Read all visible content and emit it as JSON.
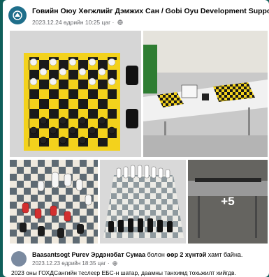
{
  "post": {
    "page_name": "Говийн Оюу Хөгжлийг Дэмжих Сан / Gobi Oyu Development Support Fund",
    "time": "2023.12.24 өдрийн 10:25 цаг ·"
  },
  "photos": {
    "more_label": "+5"
  },
  "tagged": {
    "people": "Baasantsogt Purev Эрдэнэбат Сумаа",
    "joiner": " болон ",
    "others": "өөр 2 хүнтэй",
    "suffix": " хамт байна.",
    "time": "2023.12.23 өдрийн 18:35 цаг ·"
  },
  "body_text": "2023 оны ГОХДСангийн тєслєєр ЕБС-н шатар, даамны танхимд тохьжилт хийгдв.",
  "colors": {
    "background": "#0f5f5a",
    "text": "#050505",
    "muted": "#65676b"
  }
}
